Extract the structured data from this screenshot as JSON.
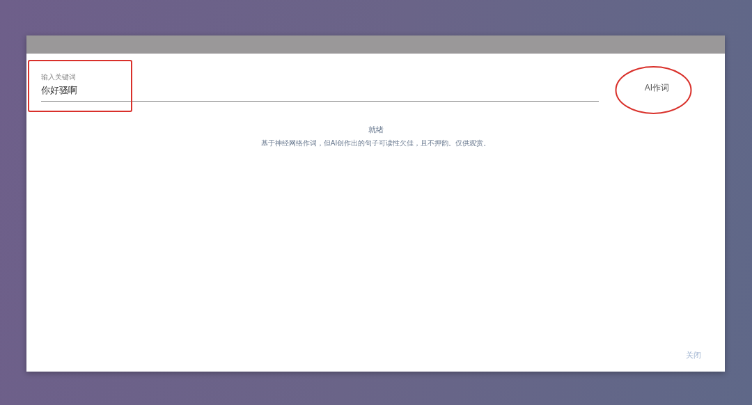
{
  "dialog": {
    "field": {
      "label": "输入关键词",
      "value": "你好骚啊"
    },
    "generate_button": "AI作词",
    "status": "就绪",
    "description": "基于神经网络作词，但AI创作出的句子可读性欠佳，且不押韵。仅供观赏。",
    "close_button": "关闭"
  }
}
